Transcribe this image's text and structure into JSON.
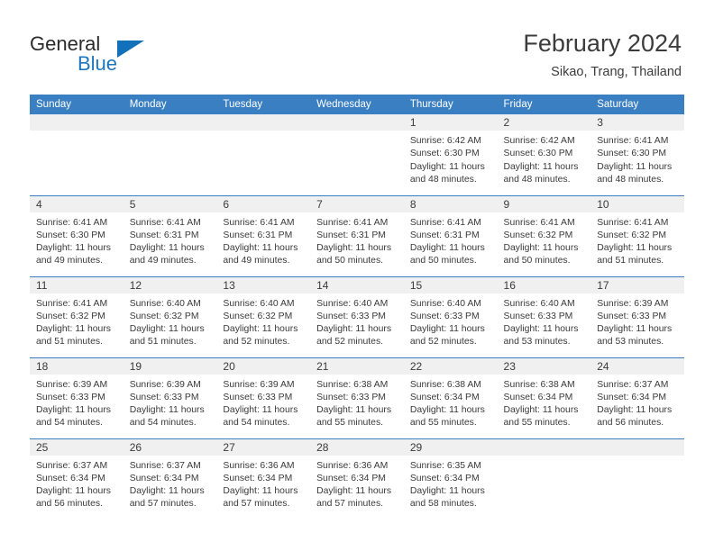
{
  "brand": {
    "name_part1": "General",
    "name_part2": "Blue",
    "triangle_color": "#1271b8",
    "blue_color": "#1e76bd"
  },
  "header": {
    "title": "February 2024",
    "location": "Sikao, Trang, Thailand"
  },
  "theme": {
    "header_blue": "#3a7fc1",
    "daynum_strip": "#f0f0f0",
    "text": "#3a3a3a"
  },
  "weekday_headers": [
    "Sunday",
    "Monday",
    "Tuesday",
    "Wednesday",
    "Thursday",
    "Friday",
    "Saturday"
  ],
  "weeks": [
    [
      {
        "day": "",
        "sunrise": "",
        "sunset": "",
        "daylight_line1": "",
        "daylight_line2": ""
      },
      {
        "day": "",
        "sunrise": "",
        "sunset": "",
        "daylight_line1": "",
        "daylight_line2": ""
      },
      {
        "day": "",
        "sunrise": "",
        "sunset": "",
        "daylight_line1": "",
        "daylight_line2": ""
      },
      {
        "day": "",
        "sunrise": "",
        "sunset": "",
        "daylight_line1": "",
        "daylight_line2": ""
      },
      {
        "day": "1",
        "sunrise": "Sunrise: 6:42 AM",
        "sunset": "Sunset: 6:30 PM",
        "daylight_line1": "Daylight: 11 hours",
        "daylight_line2": "and 48 minutes."
      },
      {
        "day": "2",
        "sunrise": "Sunrise: 6:42 AM",
        "sunset": "Sunset: 6:30 PM",
        "daylight_line1": "Daylight: 11 hours",
        "daylight_line2": "and 48 minutes."
      },
      {
        "day": "3",
        "sunrise": "Sunrise: 6:41 AM",
        "sunset": "Sunset: 6:30 PM",
        "daylight_line1": "Daylight: 11 hours",
        "daylight_line2": "and 48 minutes."
      }
    ],
    [
      {
        "day": "4",
        "sunrise": "Sunrise: 6:41 AM",
        "sunset": "Sunset: 6:30 PM",
        "daylight_line1": "Daylight: 11 hours",
        "daylight_line2": "and 49 minutes."
      },
      {
        "day": "5",
        "sunrise": "Sunrise: 6:41 AM",
        "sunset": "Sunset: 6:31 PM",
        "daylight_line1": "Daylight: 11 hours",
        "daylight_line2": "and 49 minutes."
      },
      {
        "day": "6",
        "sunrise": "Sunrise: 6:41 AM",
        "sunset": "Sunset: 6:31 PM",
        "daylight_line1": "Daylight: 11 hours",
        "daylight_line2": "and 49 minutes."
      },
      {
        "day": "7",
        "sunrise": "Sunrise: 6:41 AM",
        "sunset": "Sunset: 6:31 PM",
        "daylight_line1": "Daylight: 11 hours",
        "daylight_line2": "and 50 minutes."
      },
      {
        "day": "8",
        "sunrise": "Sunrise: 6:41 AM",
        "sunset": "Sunset: 6:31 PM",
        "daylight_line1": "Daylight: 11 hours",
        "daylight_line2": "and 50 minutes."
      },
      {
        "day": "9",
        "sunrise": "Sunrise: 6:41 AM",
        "sunset": "Sunset: 6:32 PM",
        "daylight_line1": "Daylight: 11 hours",
        "daylight_line2": "and 50 minutes."
      },
      {
        "day": "10",
        "sunrise": "Sunrise: 6:41 AM",
        "sunset": "Sunset: 6:32 PM",
        "daylight_line1": "Daylight: 11 hours",
        "daylight_line2": "and 51 minutes."
      }
    ],
    [
      {
        "day": "11",
        "sunrise": "Sunrise: 6:41 AM",
        "sunset": "Sunset: 6:32 PM",
        "daylight_line1": "Daylight: 11 hours",
        "daylight_line2": "and 51 minutes."
      },
      {
        "day": "12",
        "sunrise": "Sunrise: 6:40 AM",
        "sunset": "Sunset: 6:32 PM",
        "daylight_line1": "Daylight: 11 hours",
        "daylight_line2": "and 51 minutes."
      },
      {
        "day": "13",
        "sunrise": "Sunrise: 6:40 AM",
        "sunset": "Sunset: 6:32 PM",
        "daylight_line1": "Daylight: 11 hours",
        "daylight_line2": "and 52 minutes."
      },
      {
        "day": "14",
        "sunrise": "Sunrise: 6:40 AM",
        "sunset": "Sunset: 6:33 PM",
        "daylight_line1": "Daylight: 11 hours",
        "daylight_line2": "and 52 minutes."
      },
      {
        "day": "15",
        "sunrise": "Sunrise: 6:40 AM",
        "sunset": "Sunset: 6:33 PM",
        "daylight_line1": "Daylight: 11 hours",
        "daylight_line2": "and 52 minutes."
      },
      {
        "day": "16",
        "sunrise": "Sunrise: 6:40 AM",
        "sunset": "Sunset: 6:33 PM",
        "daylight_line1": "Daylight: 11 hours",
        "daylight_line2": "and 53 minutes."
      },
      {
        "day": "17",
        "sunrise": "Sunrise: 6:39 AM",
        "sunset": "Sunset: 6:33 PM",
        "daylight_line1": "Daylight: 11 hours",
        "daylight_line2": "and 53 minutes."
      }
    ],
    [
      {
        "day": "18",
        "sunrise": "Sunrise: 6:39 AM",
        "sunset": "Sunset: 6:33 PM",
        "daylight_line1": "Daylight: 11 hours",
        "daylight_line2": "and 54 minutes."
      },
      {
        "day": "19",
        "sunrise": "Sunrise: 6:39 AM",
        "sunset": "Sunset: 6:33 PM",
        "daylight_line1": "Daylight: 11 hours",
        "daylight_line2": "and 54 minutes."
      },
      {
        "day": "20",
        "sunrise": "Sunrise: 6:39 AM",
        "sunset": "Sunset: 6:33 PM",
        "daylight_line1": "Daylight: 11 hours",
        "daylight_line2": "and 54 minutes."
      },
      {
        "day": "21",
        "sunrise": "Sunrise: 6:38 AM",
        "sunset": "Sunset: 6:33 PM",
        "daylight_line1": "Daylight: 11 hours",
        "daylight_line2": "and 55 minutes."
      },
      {
        "day": "22",
        "sunrise": "Sunrise: 6:38 AM",
        "sunset": "Sunset: 6:34 PM",
        "daylight_line1": "Daylight: 11 hours",
        "daylight_line2": "and 55 minutes."
      },
      {
        "day": "23",
        "sunrise": "Sunrise: 6:38 AM",
        "sunset": "Sunset: 6:34 PM",
        "daylight_line1": "Daylight: 11 hours",
        "daylight_line2": "and 55 minutes."
      },
      {
        "day": "24",
        "sunrise": "Sunrise: 6:37 AM",
        "sunset": "Sunset: 6:34 PM",
        "daylight_line1": "Daylight: 11 hours",
        "daylight_line2": "and 56 minutes."
      }
    ],
    [
      {
        "day": "25",
        "sunrise": "Sunrise: 6:37 AM",
        "sunset": "Sunset: 6:34 PM",
        "daylight_line1": "Daylight: 11 hours",
        "daylight_line2": "and 56 minutes."
      },
      {
        "day": "26",
        "sunrise": "Sunrise: 6:37 AM",
        "sunset": "Sunset: 6:34 PM",
        "daylight_line1": "Daylight: 11 hours",
        "daylight_line2": "and 57 minutes."
      },
      {
        "day": "27",
        "sunrise": "Sunrise: 6:36 AM",
        "sunset": "Sunset: 6:34 PM",
        "daylight_line1": "Daylight: 11 hours",
        "daylight_line2": "and 57 minutes."
      },
      {
        "day": "28",
        "sunrise": "Sunrise: 6:36 AM",
        "sunset": "Sunset: 6:34 PM",
        "daylight_line1": "Daylight: 11 hours",
        "daylight_line2": "and 57 minutes."
      },
      {
        "day": "29",
        "sunrise": "Sunrise: 6:35 AM",
        "sunset": "Sunset: 6:34 PM",
        "daylight_line1": "Daylight: 11 hours",
        "daylight_line2": "and 58 minutes."
      },
      {
        "day": "",
        "sunrise": "",
        "sunset": "",
        "daylight_line1": "",
        "daylight_line2": ""
      },
      {
        "day": "",
        "sunrise": "",
        "sunset": "",
        "daylight_line1": "",
        "daylight_line2": ""
      }
    ]
  ]
}
